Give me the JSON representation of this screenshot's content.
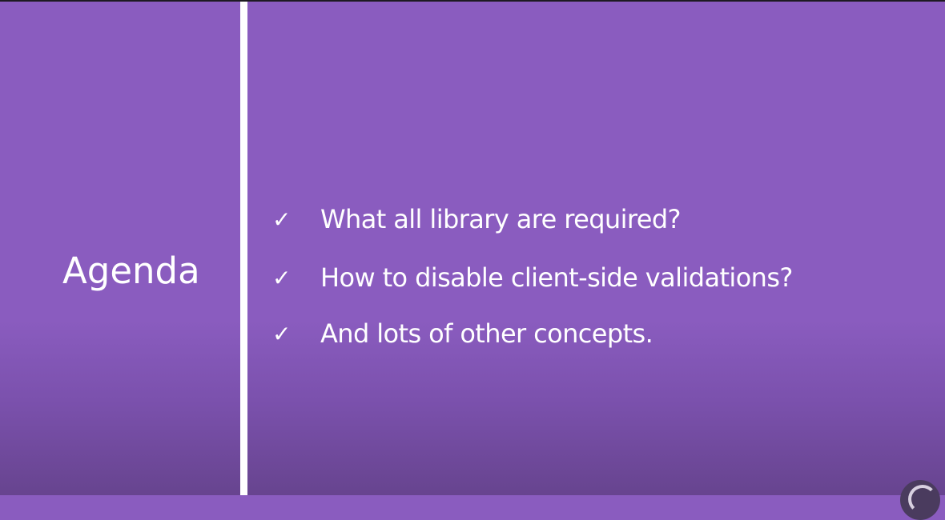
{
  "slide": {
    "title": "Agenda",
    "items": [
      {
        "icon": "checkmark-icon",
        "check": "✓",
        "text": "What all library are required?"
      },
      {
        "icon": "checkmark-icon",
        "check": "✓",
        "text": "How to disable client-side validations?"
      },
      {
        "icon": "checkmark-icon",
        "check": "✓",
        "text": "And lots of other concepts."
      }
    ]
  },
  "colors": {
    "background": "#8a5cbf",
    "divider": "#ffffff",
    "text": "#ffffff"
  }
}
